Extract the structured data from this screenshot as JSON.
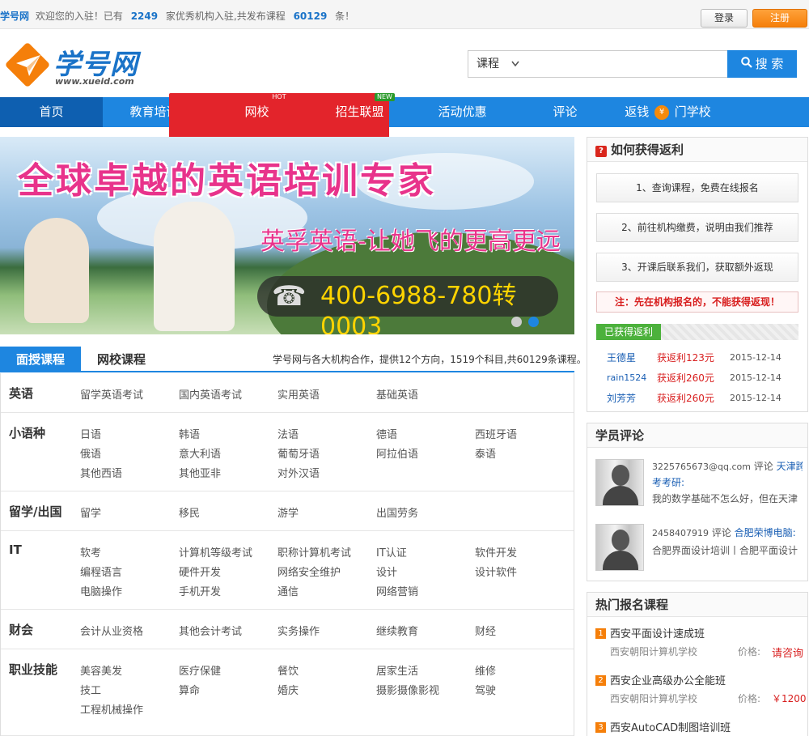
{
  "topbar": {
    "brand": "学号网",
    "welcome": "欢迎您的入驻！已有",
    "org_count": "2249",
    "mid": "家优秀机构入驻,共发布课程",
    "course_count": "60129",
    "tail": "条！",
    "login": "登录",
    "register": "注册"
  },
  "logo": {
    "name": "学号网",
    "url": "www.xueid.com"
  },
  "search": {
    "category": "课程",
    "placeholder": "",
    "button": "搜 索"
  },
  "nav": {
    "items": [
      {
        "label": "首页"
      },
      {
        "label": "教育培训",
        "badge": "HOT"
      },
      {
        "label": "网校"
      },
      {
        "label": "招生联盟",
        "badge": "NEW"
      },
      {
        "label": "活动优惠"
      },
      {
        "label": "评论"
      },
      {
        "label": "返钱",
        "chip": "¥",
        "after": "门学校"
      }
    ]
  },
  "banner": {
    "title": "全球卓越的英语培训专家",
    "subtitle": "英孚英语-让她飞的更高更远",
    "phone": "400-6988-780转0003"
  },
  "course_tabs": {
    "tab1": "面授课程",
    "tab2": "网校课程",
    "info": "学号网与各大机构合作，提供12个方向，1519个科目,共60129条课程。"
  },
  "categories": [
    {
      "title": "英语",
      "links": [
        "留学英语考试",
        "国内英语考试",
        "实用英语",
        "基础英语"
      ]
    },
    {
      "title": "小语种",
      "links": [
        "日语",
        "韩语",
        "法语",
        "德语",
        "西班牙语",
        "俄语",
        "意大利语",
        "葡萄牙语",
        "阿拉伯语",
        "泰语",
        "其他西语",
        "其他亚非",
        "对外汉语"
      ]
    },
    {
      "title": "留学/出国",
      "links": [
        "留学",
        "移民",
        "游学",
        "出国劳务"
      ]
    },
    {
      "title": "IT",
      "links": [
        "软考",
        "计算机等级考试",
        "职称计算机考试",
        "IT认证",
        "软件开发",
        "编程语言",
        "硬件开发",
        "网络安全维护",
        "设计",
        "设计软件",
        "电脑操作",
        "手机开发",
        "通信",
        "网络营销"
      ]
    },
    {
      "title": "财会",
      "links": [
        "会计从业资格",
        "其他会计考试",
        "实务操作",
        "继续教育",
        "财经"
      ]
    },
    {
      "title": "职业技能",
      "links": [
        "美容美发",
        "医疗保健",
        "餐饮",
        "居家生活",
        "维修",
        "技工",
        "算命",
        "婚庆",
        "摄影摄像影视",
        "驾驶",
        "工程机械操作"
      ]
    }
  ],
  "rebate_box": {
    "title": "如何获得返利",
    "q_icon": "?",
    "steps": [
      "1、查询课程，免费在线报名",
      "2、前往机构缴费，说明由我们推荐",
      "3、开课后联系我们，获取额外返现"
    ],
    "notice": "注：先在机构报名的，不能获得返现！",
    "earned_label": "已获得返利",
    "records": [
      {
        "user": "王德星",
        "amount": "获返利123元",
        "date": "2015-12-14"
      },
      {
        "user": "rain1524",
        "amount": "获返利260元",
        "date": "2015-12-14"
      },
      {
        "user": "刘芳芳",
        "amount": "获返利260元",
        "date": "2015-12-14"
      }
    ]
  },
  "reviews_box": {
    "title": "学员评论",
    "items": [
      {
        "user": "3225765673@qq.com",
        "verb": "评论",
        "target": "天津跨",
        "target2": "考考研:",
        "text": "我的数学基础不怎么好，但在天津"
      },
      {
        "user": "2458407919",
        "verb": "评论",
        "target": "合肥荣博电脑:",
        "text": "合肥界面设计培训丨合肥平面设计"
      }
    ]
  },
  "hot_box": {
    "title": "热门报名课程",
    "price_label": "价格:",
    "items": [
      {
        "no": "1",
        "title": "西安平面设计速成班",
        "school": "西安朝阳计算机学校",
        "price": "请咨询"
      },
      {
        "no": "2",
        "title": "西安企业高级办公全能班",
        "school": "西安朝阳计算机学校",
        "price": "￥1200"
      },
      {
        "no": "3",
        "title": "西安AutoCAD制图培训班",
        "school": "",
        "price": ""
      }
    ]
  },
  "colors": {
    "primary": "#1e86e0",
    "nav_active": "#0e5fb0",
    "accent": "#f57f0a",
    "alert": "#d81e1e",
    "success": "#4cb13c"
  }
}
